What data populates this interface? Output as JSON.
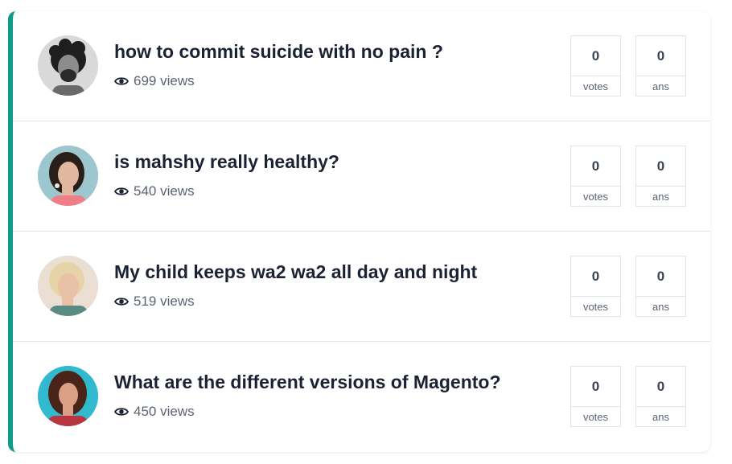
{
  "questions": [
    {
      "title": "how to commit suicide with no pain ?",
      "views": "699 views",
      "votes": "0",
      "votes_label": "votes",
      "answers": "0",
      "answers_label": "ans",
      "avatar_colors": {
        "bg": "#d9d9d9",
        "skin": "#8c8c8c",
        "hair": "#1e1e1e",
        "shirt": "#6a6a6a"
      }
    },
    {
      "title": "is mahshy really healthy?",
      "views": "540 views",
      "votes": "0",
      "votes_label": "votes",
      "answers": "0",
      "answers_label": "ans",
      "avatar_colors": {
        "bg": "#9cc7cf",
        "skin": "#e0b8a0",
        "hair": "#2a1e18",
        "shirt": "#f07e86"
      }
    },
    {
      "title": "My child keeps wa2 wa2 all day and night",
      "views": "519 views",
      "votes": "0",
      "votes_label": "votes",
      "answers": "0",
      "answers_label": "ans",
      "avatar_colors": {
        "bg": "#eadfd2",
        "skin": "#e8c1a6",
        "hair": "#e6d3a8",
        "shirt": "#5a8a82"
      }
    },
    {
      "title": "What are the different versions of Magento?",
      "views": "450 views",
      "votes": "0",
      "votes_label": "votes",
      "answers": "0",
      "answers_label": "ans",
      "avatar_colors": {
        "bg": "#31b9cf",
        "skin": "#d9a086",
        "hair": "#4a2418",
        "shirt": "#b83440"
      }
    }
  ],
  "accent_color": "#0f9a8a"
}
